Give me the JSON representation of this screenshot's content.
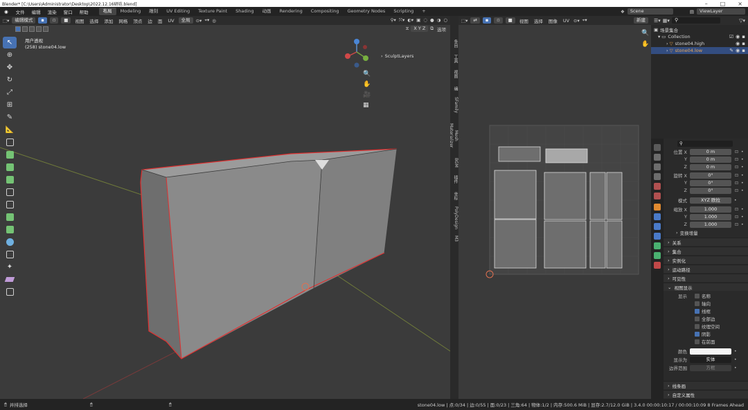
{
  "window": {
    "title": "Blender* [C:\\Users\\Administrator\\Desktop\\2022.12.16研坊.blend]"
  },
  "menu": [
    "文件",
    "编辑",
    "渲染",
    "窗口",
    "帮助"
  ],
  "workspaces": [
    "布局",
    "Modeling",
    "雕刻",
    "UV Editing",
    "Texture Paint",
    "Shading",
    "动画",
    "Rendering",
    "Compositing",
    "Geometry Nodes",
    "Scripting"
  ],
  "workspace_add": "+",
  "scene": {
    "name": "Scene",
    "view_layer": "ViewLayer"
  },
  "viewport": {
    "mode": "编辑模式",
    "menus": [
      "视图",
      "选择",
      "添加",
      "网格",
      "顶点",
      "边",
      "面",
      "UV"
    ],
    "transform": "全局",
    "view_name": "用户透视",
    "object_info": "(258) stone04.low",
    "axes": "X Y Z",
    "options": "选项",
    "sculpt_layers": "SculptLayers",
    "side_tabs": [
      "条目",
      "工具",
      "视图",
      "编",
      "SFamily",
      "Mesh Materializer",
      "BGM",
      "插件",
      "坐标",
      "PolyDesign",
      "M3"
    ]
  },
  "uv_editor": {
    "menus": [
      "视图",
      "选择",
      "图像",
      "UV"
    ],
    "new_button": "新建"
  },
  "outliner": {
    "scene_collection": "场景集合",
    "collection": "Collection",
    "objects": [
      "stone04.high",
      "stone04.low"
    ]
  },
  "properties": {
    "location": {
      "label": "位置 X",
      "values": [
        "0 m",
        "0 m",
        "0 m"
      ]
    },
    "rotation": {
      "label": "旋转 X",
      "values": [
        "0°",
        "0°",
        "0°"
      ]
    },
    "mode": {
      "label": "模式",
      "value": "XYZ 欧拉"
    },
    "scale": {
      "label": "缩放 X",
      "values": [
        "1.000",
        "1.000",
        "1.000"
      ]
    },
    "axis_y": "Y",
    "axis_z": "Z",
    "delta": "变换增量",
    "sections": [
      "关系",
      "集合",
      "实例化",
      "运动路径",
      "可见性",
      "视图显示"
    ],
    "display_label": "显示",
    "display_options": [
      {
        "label": "名称",
        "checked": false
      },
      {
        "label": "轴向",
        "checked": false
      },
      {
        "label": "线框",
        "checked": true
      },
      {
        "label": "全部边",
        "checked": false
      },
      {
        "label": "纹理空间",
        "checked": false
      },
      {
        "label": "阴影",
        "checked": true
      },
      {
        "label": "在前面",
        "checked": false
      }
    ],
    "color_label": "颜色",
    "display_as": {
      "label": "显示为",
      "value": "实体"
    },
    "bounds": {
      "label": "边界范围",
      "value": "方框"
    },
    "bottom_sections": [
      "线条画",
      "自定义属性"
    ]
  },
  "status": {
    "left": "并排选择",
    "right": "stone04.low | 点:0/34 | 边:0/55 | 面:0/23 | 三角:64 | 物体:1/2 | 内存:500.6 MiB | 显存:2.7/12.0 GiB | 3.4.0  00:00:10:17 / 00:00:10:09  8 Frames Ahead"
  }
}
